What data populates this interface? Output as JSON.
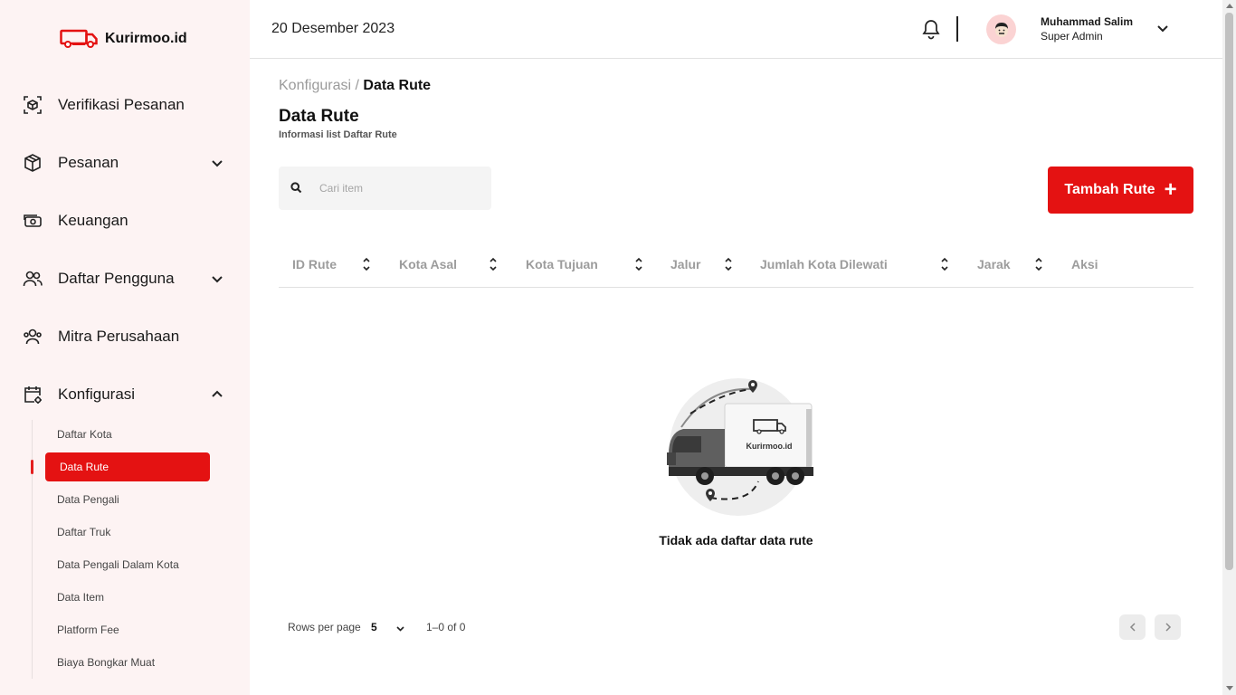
{
  "app": {
    "name": "Kurirmoo.id"
  },
  "header": {
    "date": "20 Desember 2023",
    "user": {
      "name": "Muhammad Salim",
      "role": "Super Admin"
    }
  },
  "sidebar": {
    "items": [
      {
        "label": "Verifikasi Pesanan",
        "icon": "box-scan-icon"
      },
      {
        "label": "Pesanan",
        "icon": "package-icon"
      },
      {
        "label": "Keuangan",
        "icon": "money-icon"
      },
      {
        "label": "Daftar Pengguna",
        "icon": "users-icon"
      },
      {
        "label": "Mitra Perusahaan",
        "icon": "partners-icon"
      },
      {
        "label": "Konfigurasi",
        "icon": "config-icon"
      }
    ],
    "sub_items": [
      "Daftar Kota",
      "Data Rute",
      "Data Pengali",
      "Daftar Truk",
      "Data Pengali Dalam Kota",
      "Data Item",
      "Platform Fee",
      "Biaya Bongkar Muat"
    ],
    "active_sub": "Data Rute"
  },
  "breadcrumb": {
    "parent": "Konfigurasi",
    "separator": " / ",
    "current": "Data Rute"
  },
  "page": {
    "title": "Data Rute",
    "subtitle": "Informasi list Daftar Rute"
  },
  "search": {
    "placeholder": "Cari item"
  },
  "add_button": {
    "label": "Tambah Rute"
  },
  "table": {
    "columns": [
      "ID Rute",
      "Kota Asal",
      "Kota Tujuan",
      "Jalur",
      "Jumlah Kota Dilewati",
      "Jarak",
      "Aksi"
    ],
    "rows": [],
    "empty_message": "Tidak ada daftar data rute",
    "illustration_logo": "Kurirmoo.id"
  },
  "pagination": {
    "rows_per_page_label": "Rows per page",
    "rows_per_page": "5",
    "range": "1–0 of 0"
  },
  "colors": {
    "accent": "#e41212",
    "sidebar_bg": "#fdf3f3"
  }
}
